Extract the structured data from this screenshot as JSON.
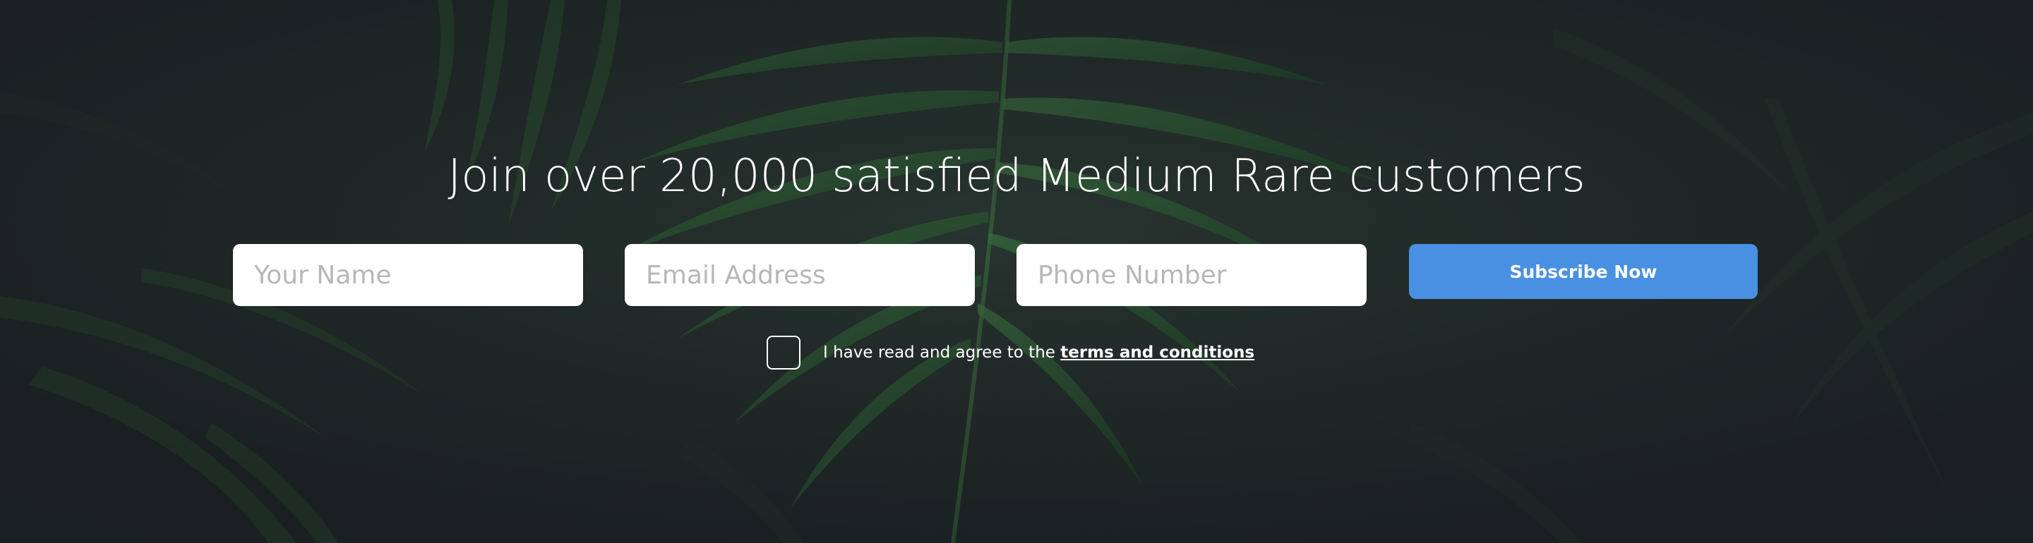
{
  "hero": {
    "headline": "Join over 20,000 satisfied Medium Rare customers",
    "background_color": "#232a2c",
    "background_image": "tropical-palm-leaves"
  },
  "form": {
    "name_placeholder": "Your Name",
    "email_placeholder": "Email Address",
    "phone_placeholder": "Phone Number",
    "submit_label": "Subscribe Now",
    "submit_color": "#4a90e2",
    "agree_prefix": "I have read and agree to the",
    "terms_link": "terms and conditions",
    "agree_checked": false
  }
}
